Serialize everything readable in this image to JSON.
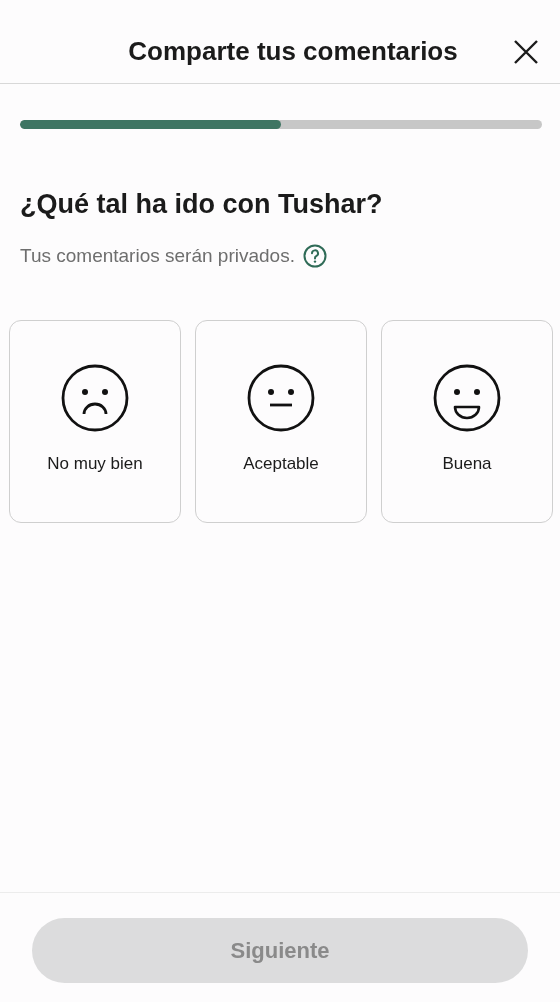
{
  "header": {
    "title": "Comparte tus comentarios"
  },
  "progress": {
    "level": 0.5
  },
  "question": {
    "heading": "¿Qué tal ha ido con Tushar?",
    "note": "Tus comentarios serán privados."
  },
  "options": [
    {
      "kind": "sad",
      "label": "No muy bien",
      "selected": false
    },
    {
      "kind": "neutral",
      "label": "Aceptable",
      "selected": false
    },
    {
      "kind": "happy",
      "label": "Buena",
      "selected": false
    }
  ],
  "footer": {
    "button": {
      "label": "Siguiente",
      "disabled": true
    }
  }
}
